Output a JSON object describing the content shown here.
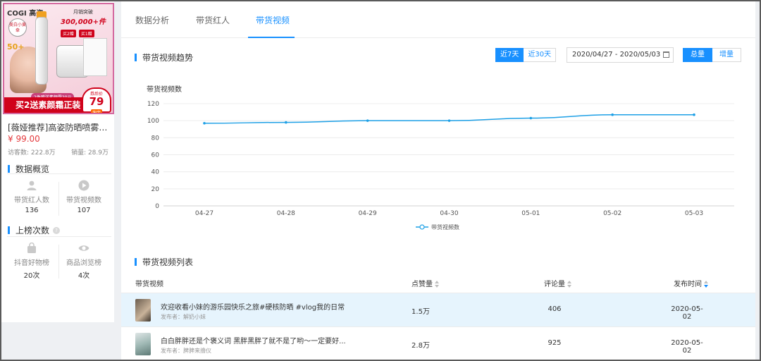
{
  "product": {
    "image": {
      "brand": "COGI 高姿",
      "tag": "美白小黄傘",
      "spf": "50+",
      "sale_line1": "月销突破",
      "sale_line2": "300,000+件",
      "badges": [
        "买2赠",
        "买1赠"
      ],
      "strip": "2件赠送素颜霜20元",
      "banner": "买2送素颜霜正装",
      "price_label": "券后价",
      "price_value": "79",
      "taobao": "淘宝"
    },
    "title": "[薇娅推荐]高姿防晒喷雾美...",
    "price": "¥ 99.00",
    "visits": "访客数: 222.8万",
    "sales": "销量: 28.9万"
  },
  "overview": {
    "title": "数据概览",
    "stats": [
      {
        "label": "带货红人数",
        "value": "136",
        "icon": "user-icon"
      },
      {
        "label": "带货视频数",
        "value": "107",
        "icon": "play-icon"
      }
    ]
  },
  "ranking": {
    "title": "上榜次数",
    "help": "?",
    "stats": [
      {
        "label": "抖音好物榜",
        "value": "20次",
        "icon": "bag-icon"
      },
      {
        "label": "商品浏览榜",
        "value": "4次",
        "icon": "eye-icon"
      }
    ]
  },
  "tabs": [
    {
      "label": "数据分析",
      "active": false
    },
    {
      "label": "带货红人",
      "active": false
    },
    {
      "label": "带货视频",
      "active": true
    }
  ],
  "trend": {
    "title": "带货视频趋势",
    "range_buttons": [
      {
        "label": "近7天",
        "active": true
      },
      {
        "label": "近30天",
        "active": false
      }
    ],
    "date_range": "2020/04/27 - 2020/05/03",
    "mode_buttons": [
      {
        "label": "总量",
        "active": true
      },
      {
        "label": "增量",
        "active": false
      }
    ]
  },
  "chart_data": {
    "type": "line",
    "ylabel": "带货视频数",
    "ylim": [
      0,
      120
    ],
    "yticks": [
      0,
      20,
      40,
      60,
      80,
      100,
      120
    ],
    "x": [
      "04-27",
      "04-28",
      "04-29",
      "04-30",
      "05-01",
      "05-02",
      "05-03"
    ],
    "series": [
      {
        "name": "带货视频数",
        "values": [
          97,
          98,
          100,
          100,
          103,
          107,
          107
        ],
        "color": "#1ea0e6"
      }
    ],
    "grid": true,
    "legend": "bottom"
  },
  "video_list": {
    "title": "带货视频列表",
    "columns": [
      "带货视频",
      "点赞量",
      "评论量",
      "发布时间"
    ],
    "rows": [
      {
        "title": "欢迎收看小妹的游乐园快乐之旅#硬核防晒 #vlog我的日常",
        "publisher": "发布者：解奶小妹",
        "likes": "1.5万",
        "comments": "406",
        "date": "2020-05-02"
      },
      {
        "title": "白白胖胖还是个褒义词 黑胖黑胖了就不是了哟～一定要好...",
        "publisher": "发布者：脾脾来撸仪",
        "likes": "2.8万",
        "comments": "925",
        "date": "2020-05-02"
      }
    ]
  }
}
